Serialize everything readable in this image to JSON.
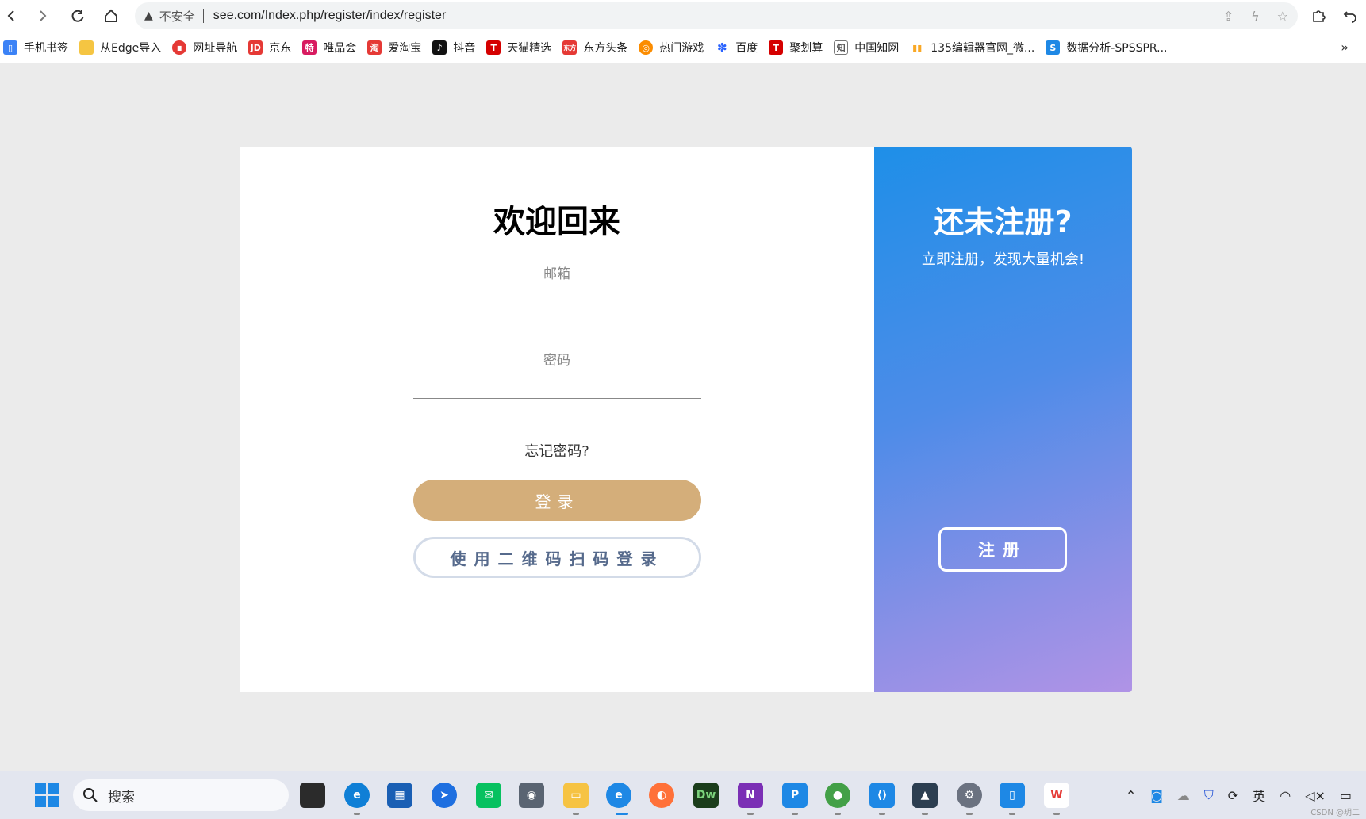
{
  "browser": {
    "insecure_label": "不安全",
    "url": "see.com/Index.php/register/index/register"
  },
  "bookmarks": [
    {
      "label": "手机书签",
      "icon": "phone-bookmark-icon",
      "color": "#3b82f6"
    },
    {
      "label": "从Edge导入",
      "icon": "folder-icon",
      "color": "#f5c542"
    },
    {
      "label": "网址导航",
      "icon": "nav-icon",
      "color": "#e53935"
    },
    {
      "label": "京东",
      "icon": "jd-icon",
      "color": "#e53935"
    },
    {
      "label": "唯品会",
      "icon": "vip-icon",
      "color": "#d81b60"
    },
    {
      "label": "爱淘宝",
      "icon": "taobao-icon",
      "color": "#e53935"
    },
    {
      "label": "抖音",
      "icon": "douyin-icon",
      "color": "#111111"
    },
    {
      "label": "天猫精选",
      "icon": "tmall-icon",
      "color": "#d50000"
    },
    {
      "label": "东方头条",
      "icon": "toutiao-icon",
      "color": "#e53935"
    },
    {
      "label": "热门游戏",
      "icon": "game-icon",
      "color": "#fb8c00"
    },
    {
      "label": "百度",
      "icon": "baidu-icon",
      "color": "#2962ff"
    },
    {
      "label": "聚划算",
      "icon": "juhuasuan-icon",
      "color": "#d50000"
    },
    {
      "label": "中国知网",
      "icon": "cnki-icon",
      "color": "#555555"
    },
    {
      "label": "135编辑器官网_微...",
      "icon": "editor-icon",
      "color": "#f9a825"
    },
    {
      "label": "数据分析-SPSSPR...",
      "icon": "spss-icon",
      "color": "#1e88e5"
    }
  ],
  "bookmarks_more": "»",
  "login": {
    "title": "欢迎回来",
    "email_label": "邮箱",
    "email_value": "",
    "password_label": "密码",
    "password_value": "",
    "forgot": "忘记密码?",
    "login_button": "登录",
    "qr_button": "使用二维码扫码登录"
  },
  "register": {
    "title": "还未注册?",
    "subtitle": "立即注册，发现大量机会!",
    "button": "注册"
  },
  "taskbar": {
    "search_label": "搜索",
    "ime_label": "英",
    "watermark": "CSDN @玥二"
  },
  "colors": {
    "login_button": "#d4ae7a",
    "register_gradient_start": "#1e8fe8",
    "register_gradient_end": "#b093e6",
    "qr_text": "#566a8c"
  }
}
